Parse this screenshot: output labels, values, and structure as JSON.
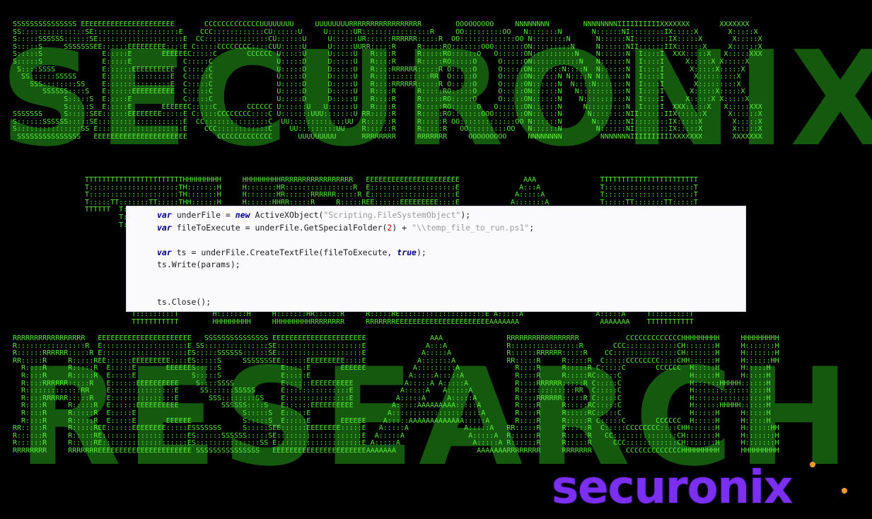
{
  "banner": {
    "word_top": "SECURONIX",
    "word_bottom": "RESEARCH",
    "ascii_top": [
      "SSSSSSSSSSSSSSS EEEEEEEEEEEEEEEEEEEEEE       CCCCCCCCCCCCCUUUUUUUU     UUUUUUUURRRRRRRRRRRRRRRRR        OOOOOOOOO     NNNNNNNN        NNNNNNNNIIIIIIIIIIXXXXXXX       XXXXXXX",
      "SS:::::::::::::::SE::::::::::::::::::::E    CCC::::::::::::CU::::::U     U::::::UR::::::::::::::::R     OO:::::::::OO   N:::::::N       N::::::NI::::::::IX:::::X       X:::::X",
      "S:::::SSSSSS::::::SE::::::::::::::::::::E  CC:::::::::::::::CU::::::U     U::::::UR::::::RRRRRR:::::R  OO:::::::::::::OO N::::::::N      N::::::NI::::::::IX:::::X       X:::::X",
      "S:::::S     SSSSSSSEE::::::EEEEEEEEE::::E C:::::CCCCCCCC::::CUU:::::U     U:::::UURR:::::R     R:::::RO:::::::OOO:::::::ON:::::::::N     N::::::NII::::::IIX::::::X     X::::::X",
      "S:::::S              E:::::E       EEEEEEC:::::C       CCCCCC U:::::U     U:::::U   R::::R     R:::::RO::::::O   O::::::ON::::::::::N    N::::::N  I::::I  XXX:::::X   X:::::XXX",
      "S:::::S              E:::::E            C:::::C               U:::::D     D:::::U   R::::R     R:::::RO:::::O     O:::::ON:::::::::::N   N::::::N  I::::I     X:::::X X:::::X",
      " S::::SSSS           E::::::EEEEEEEEEE  C:::::C               U:::::D     D:::::U   R::::RRRRRR:::::R O:::::O     O:::::ON:::::::N::::N  N::::::N  I::::I      X:::::X:::::X",
      "  SS::::::SSSSS      E:::::::::::::::E  C:::::C               U:::::D     D:::::U   R:::::::::::::RR  O:::::O     O:::::ON::::::N N::::N N::::::N  I::::I       X:::::::::X",
      "    SSS::::::::SS    E:::::::::::::::E  C:::::C               U:::::D     D:::::U   R::::RRRRRR:::::R O:::::O     O:::::ON::::::N  N::::N:::::::N  I::::I       X:::::::::X",
      "       SSSSSS::::S   E::::::EEEEEEEEEE  C:::::C               U:::::D     D:::::U   R::::R     R:::::RO:::::O     O:::::ON::::::N   N:::::::::::N  I::::I      X:::::X:::::X",
      "            S:::::S  E:::::E            C:::::C               U:::::D     D:::::U   R::::R     R:::::RO:::::O     O:::::ON::::::N    N::::::::::N  I::::I     X:::::X X:::::X",
      "            S:::::S  E:::::E       EEEEEEC:::::C       CCCCCC U::::::U   U::::::U   R::::R     R:::::RO::::::O   O::::::ON::::::N     N:::::::::N  I::::I  XXX:::::X   X:::::XXX",
      "SSSSSSS     S:::::SEE::::::EEEEEEEE:::::E C:::::CCCCCCCC::::C U:::::::UUU:::::::U RR:::::R     R:::::RO:::::::OOO:::::::ON::::::N      N::::::::NII::::::IIX::::::X     X::::::X",
      "S::::::SSSSSS:::::SE::::::::::::::::::::E  CC:::::::::::::::C  UU:::::::::::::UU  R::::::R     R:::::R OO:::::::::::::OO N::::::N       N:::::::NI::::::::IX:::::X       X:::::X",
      "S:::::::::::::::SS E::::::::::::::::::::E    CCC::::::::::::C    UU:::::::::UU    R::::::R     R:::::R   OO:::::::::OO   N::::::N        N::::::NI::::::::IX:::::X       X:::::X",
      " SSSSSSSSSSSSSSS   EEEEEEEEEEEEEEEEEEEEEE       CCCCCCCCCCCCC      UUUUUUUUU      RRRRRRRR     RRRRRRR     OOOOOOOOO     NNNNNNNN         NNNNNNNIIIIIIIIIIXXXXXXX       XXXXXXX"
    ],
    "ascii_mid": [
      "TTTTTTTTTTTTTTTTTTTTTTTHHHHHHHHH     HHHHHHHHHRRRRRRRRRRRRRRRRR   EEEEEEEEEEEEEEEEEEEEEE               AAA               TTTTTTTTTTTTTTTTTTTTTTT",
      "T:::::::::::::::::::::TH:::::::H     H:::::::HR::::::::::::::::R  E::::::::::::::::::::E              A:::A              T:::::::::::::::::::::T",
      "T:::::::::::::::::::::TH:::::::H     H:::::::HR::::::RRRRRR:::::R E::::::::::::::::::::E             A:::::A             T:::::::::::::::::::::T",
      "T:::::TT:::::::TT:::::THH::::::H     H::::::HHRR:::::R     R:::::REE::::::EEEEEEEEE::::E            A:::::::A            T:::::TT:::::::TT:::::T",
      "TTTTTT  T:::::T  TTTTTT  H:::::H     H:::::H    R::::R     R:::::R  E:::::E       EEEEEE           A:::::::::A           TTTTTT  T:::::T  TTTTTT",
      "        T:::::T          H:::::H     H:::::H    R::::R     R:::::R  E:::::E                       A:::::A:::::A                  T:::::T",
      "        T:::::T          H::::::HHHHH::::::H    R::::RRRRRR:::::R   E::::::EEEEEEEEEE            A:::::A A:::::A                 T:::::T"
    ],
    "ascii_mid2": [
      "      T:::::::::T        H:::::::H     H:::::::HR::::::R     R:::::RE::::::::::::::::::::E A:::::A                 A:::::A     T:::::::::T",
      "      TTTTTTTTTTT        HHHHHHHHH     HHHHHHHHHRRRRRRRR     RRRRRRREEEEEEEEEEEEEEEEEEEEEEAAAAAAA                   AAAAAAA    TTTTTTTTTTT"
    ],
    "ascii_bottom": [
      "RRRRRRRRRRRRRRRRR   EEEEEEEEEEEEEEEEEEEEEE   SSSSSSSSSSSSSSS EEEEEEEEEEEEEEEEEEEEEE               AAA               RRRRRRRRRRRRRRRRR           CCCCCCCCCCCCCHHHHHHHHH     HHHHHHHHH",
      "R::::::::::::::::R  E::::::::::::::::::::E SS:::::::::::::::SE::::::::::::::::::::E              A:::A              R::::::::::::::::R       CCC::::::::::::CH:::::::H     H:::::::H",
      "R::::::RRRRRR:::::R E::::::::::::::::::::ES:::::SSSSSS::::::SE::::::::::::::::::::E             A:::::A             R::::::RRRRRR:::::R    CC:::::::::::::::CH:::::::H     H:::::::H",
      "RR:::::R     R:::::REE::::::EEEEEEEEE::::ES:::::S     SSSSSSSEE::::::EEEEEEEEE::::E            A:::::::A            RR:::::R     R:::::R  C:::::CCCCCCCC::::CHH::::::H     H::::::HH",
      "  R::::R     R:::::R  E:::::E       EEEEEES:::::S              E:::::E       EEEEEE           A:::::::::A             R::::R     R:::::R C:::::C       CCCCCC  H:::::H     H:::::H",
      "  R::::R     R:::::R  E:::::E             S:::::S              E:::::E                       A:::::A:::::A            R::::R     R:::::RC:::::C                H:::::H     H:::::H",
      "  R::::RRRRRR:::::R   E::::::EEEEEEEEEE    S::::SSSS           E::::::EEEEEEEEEE            A:::::A A:::::A           R::::RRRRRR:::::R C:::::C                H::::::HHHHH::::::H",
      "  R:::::::::::::RR    E:::::::::::::::E     SS::::::SSSSS      E:::::::::::::::E           A:::::A   A:::::A          R:::::::::::::RR  C:::::C                H:::::::::::::::::H",
      "  R::::RRRRRR:::::R   E:::::::::::::::E       SSS::::::::SS    E:::::::::::::::E          A:::::A     A:::::A         R::::RRRRRR:::::R C:::::C                H:::::::::::::::::H",
      "  R::::R     R:::::R  E::::::EEEEEEEEEE          SSSSSS::::S   E::::::EEEEEEEEEE         A:::::AAAAAAAAA:::::A        R::::R     R:::::RC:::::C                H::::::HHHHH::::::H",
      "  R::::R     R:::::R  E:::::E                         S:::::S  E:::::E                  A:::::::::::::::::::::A       R::::R     R:::::RC:::::C                H:::::H     H:::::H",
      "  R::::R     R:::::R  E:::::E       EEEEEE            S:::::S  E:::::E       EEEEEE    A:::::AAAAAAAAAAAAA:::::A      R::::R     R:::::R C:::::C       CCCCCC  H:::::H     H:::::H",
      "RR:::::R     R:::::REE::::::EEEEEEEE:::::ESSSSSSS     S:::::SEE::::::EEEEEEEE:::::E   A:::::A             A:::::A   RR:::::R     R:::::R  C:::::CCCCCCCC::::CHH::::::H     H::::::HH",
      "R::::::R     R:::::RE::::::::::::::::::::ES::::::SSSSSS:::::SE::::::::::::::::::::E  A:::::A               A:::::A  R::::::R     R:::::R   CC:::::::::::::::CH:::::::H     H:::::::H",
      "R::::::R     R:::::RE::::::::::::::::::::ES:::::::::::::::SS E::::::::::::::::::::E A:::::A                 A:::::A R::::::R     R:::::R     CCC::::::::::::CH:::::::H     H:::::::H",
      "RRRRRRRR     RRRRRRREEEEEEEEEEEEEEEEEEEEEE SSSSSSSSSSSSSSS   EEEEEEEEEEEEEEEEEEEEEEAAAAAAA                   AAAAAAARRRRRRRR     RRRRRRR        CCCCCCCCCCCCCHHHHHHHHH     HHHHHHHHH"
    ]
  },
  "code": {
    "line1": {
      "kw": "var",
      "text": " underFile = ",
      "kw2": "new",
      "text2": " ActiveXObject(",
      "str": "\"Scripting.FileSystemObject\"",
      "end": ");"
    },
    "line2": {
      "kw": "var",
      "text": " fileToExecute = underFile.GetSpecialFolder(",
      "num": "2",
      "text2": ") + ",
      "str": "\"\\\\temp_file_to_run.ps1\"",
      "end": ";"
    },
    "line4": {
      "kw": "var",
      "text": " ts = underFile.CreateTextFile(fileToExecute, ",
      "kw2": "true",
      "end": ");"
    },
    "line5": {
      "text": "ts.Write(params);"
    },
    "line8": {
      "text": "ts.Close();"
    }
  },
  "logo": {
    "text": "securonix"
  },
  "colors": {
    "ascii_green": "#5dff3a",
    "code_bg": "#fafafd",
    "keyword": "#00008b",
    "string": "#9a9a9a",
    "number": "#d10000",
    "logo_purple": "#7b2ff0",
    "logo_dot": "#ff9a2a"
  }
}
